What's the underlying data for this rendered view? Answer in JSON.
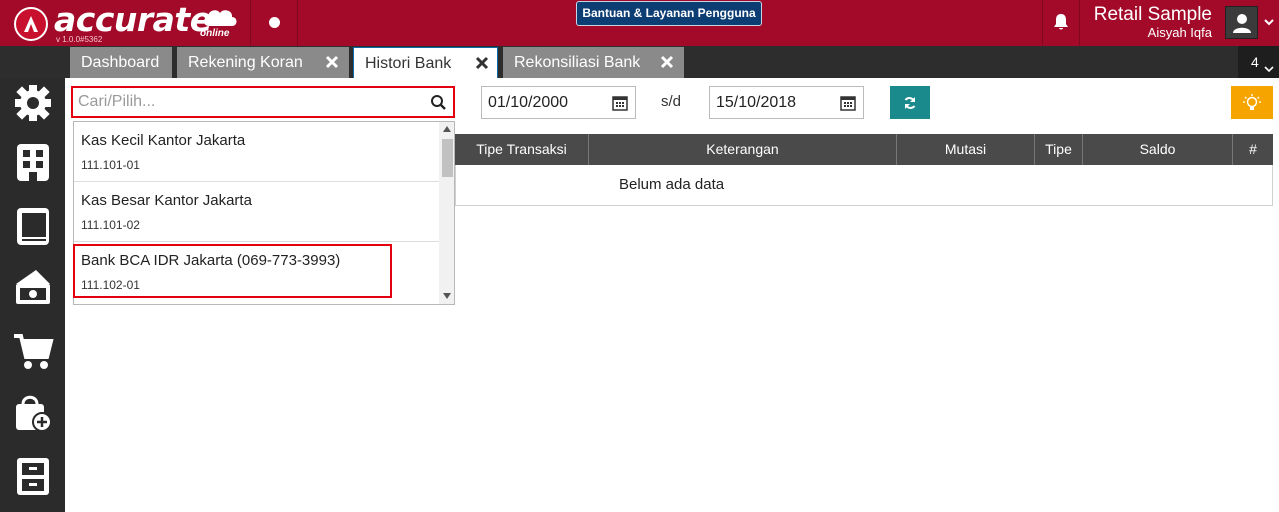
{
  "app": {
    "logo_text": "accurate",
    "logo_sub": "online",
    "version": "v 1.0.0#5362",
    "help_label": "Bantuan & Layanan Pengguna",
    "company": "Retail Sample",
    "user": "Aisyah Iqfa"
  },
  "tabs": [
    {
      "label": "Dashboard"
    },
    {
      "label": "Rekening Koran"
    },
    {
      "label": "Histori Bank"
    },
    {
      "label": "Rekonsiliasi Bank"
    }
  ],
  "tab_count": "4",
  "filter": {
    "search_placeholder": "Cari/Pilih...",
    "date_from": "01/10/2000",
    "separator": "s/d",
    "date_to": "15/10/2018"
  },
  "table": {
    "columns": [
      "Tipe Transaksi",
      "Keterangan",
      "Mutasi",
      "Tipe",
      "Saldo",
      "#"
    ],
    "empty_text": "Belum ada data"
  },
  "dropdown": {
    "items": [
      {
        "name": "Kas Kecil Kantor Jakarta",
        "code": "111.101-01"
      },
      {
        "name": "Kas Besar Kantor Jakarta",
        "code": "111.101-02"
      },
      {
        "name": "Bank BCA IDR Jakarta (069-773-3993)",
        "code": "111.102-01"
      }
    ]
  },
  "colors": {
    "brand": "#a30a2a",
    "highlight": "#e3000f",
    "refresh": "#1a8a8c",
    "idea": "#f5a400"
  },
  "icons": [
    "gear-icon",
    "building-icon",
    "book-icon",
    "money-icon",
    "cart-icon",
    "bag-add-icon",
    "cabinet-icon"
  ]
}
